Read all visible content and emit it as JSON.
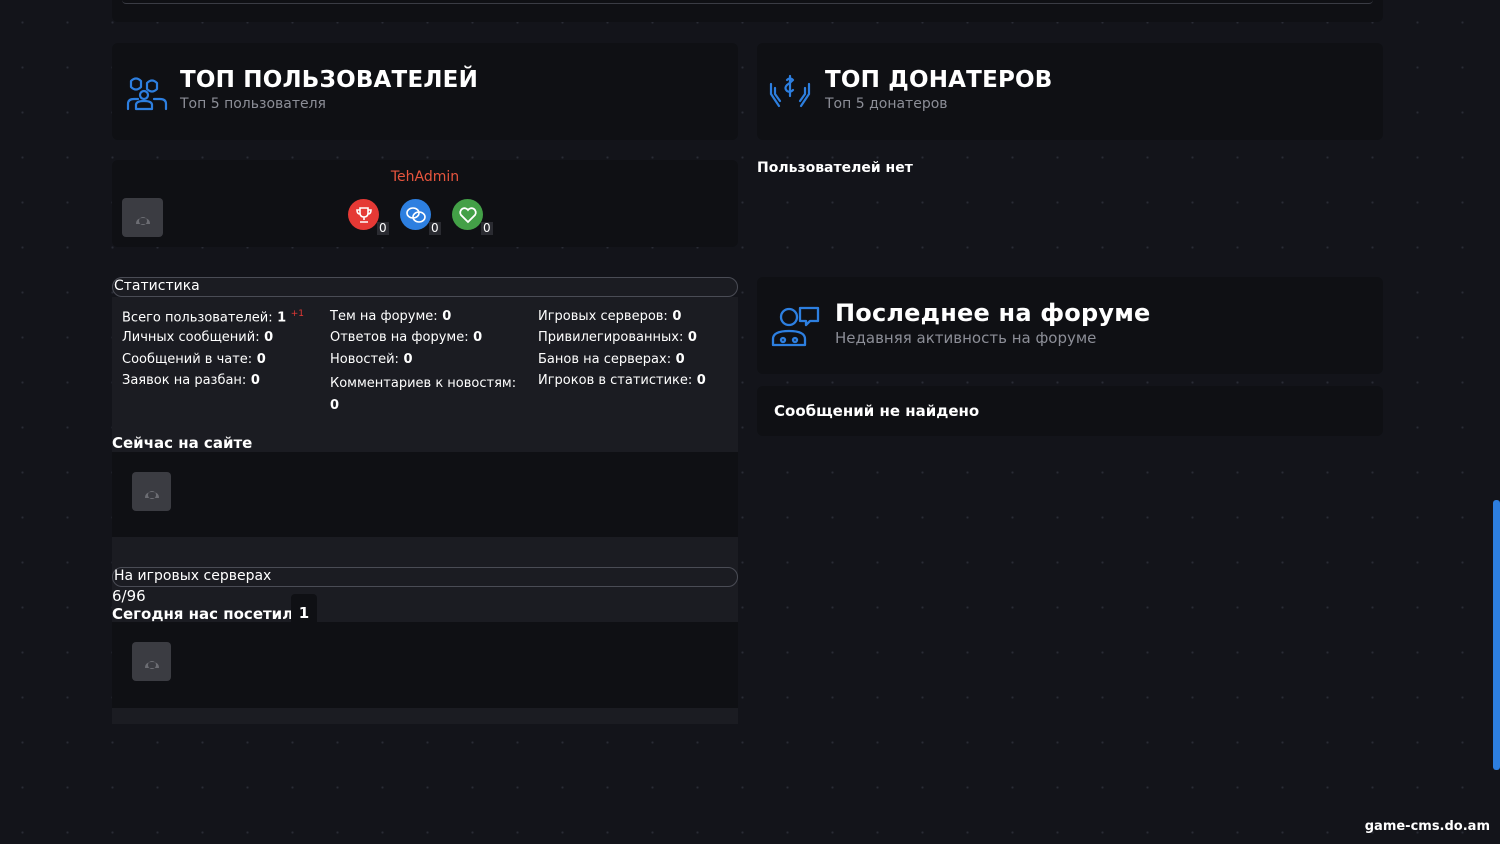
{
  "top_users": {
    "title": "ТОП ПОЛЬЗОВАТЕЛЕЙ",
    "subtitle": "Топ 5 пользователя",
    "icon": "users-icon",
    "user": {
      "name": "TehAdmin",
      "badges": [
        {
          "icon": "trophy-icon",
          "count": "0",
          "color": "#e53935"
        },
        {
          "icon": "chat-icon",
          "count": "0",
          "color": "#2d7fe0"
        },
        {
          "icon": "heart-icon",
          "count": "0",
          "color": "#43a047"
        }
      ]
    }
  },
  "top_donators": {
    "title": "ТОП ДОНАТЕРОВ",
    "subtitle": "Топ 5 донатеров",
    "icon": "donation-icon",
    "empty_text": "Пользователей нет"
  },
  "statistics": {
    "header": "Статистика",
    "col1": [
      {
        "label": "Всего пользователей:",
        "value": "1",
        "extra": "+1"
      },
      {
        "label": "Личных сообщений:",
        "value": "0"
      },
      {
        "label": "Сообщений в чате:",
        "value": "0"
      },
      {
        "label": "Заявок на разбан:",
        "value": "0"
      }
    ],
    "col2": [
      {
        "label": "Тем на форуме:",
        "value": "0"
      },
      {
        "label": "Ответов на форуме:",
        "value": "0"
      },
      {
        "label": "Новостей:",
        "value": "0"
      },
      {
        "label": "Комментариев к новостям:",
        "value": "0"
      }
    ],
    "col3": [
      {
        "label": "Игровых серверов:",
        "value": "0"
      },
      {
        "label": "Привилегированных:",
        "value": "0"
      },
      {
        "label": "Банов на серверах:",
        "value": "0"
      },
      {
        "label": "Игроков в статистике:",
        "value": "0"
      }
    ]
  },
  "online_now": {
    "title": "Сейчас на сайте"
  },
  "game_servers": {
    "header": "На игровых серверах",
    "players": "6/96",
    "today_label": "Сегодня нас посетили",
    "today_count": "1"
  },
  "forum": {
    "title": "Последнее на форуме",
    "subtitle": "Недавняя активность на форуме",
    "icon": "forum-icon",
    "empty_text": "Сообщений не найдено"
  },
  "watermark": "game-cms.do.am",
  "colors": {
    "accent": "#2d7fe0",
    "username": "#e8553e",
    "card": "#0f1014"
  }
}
